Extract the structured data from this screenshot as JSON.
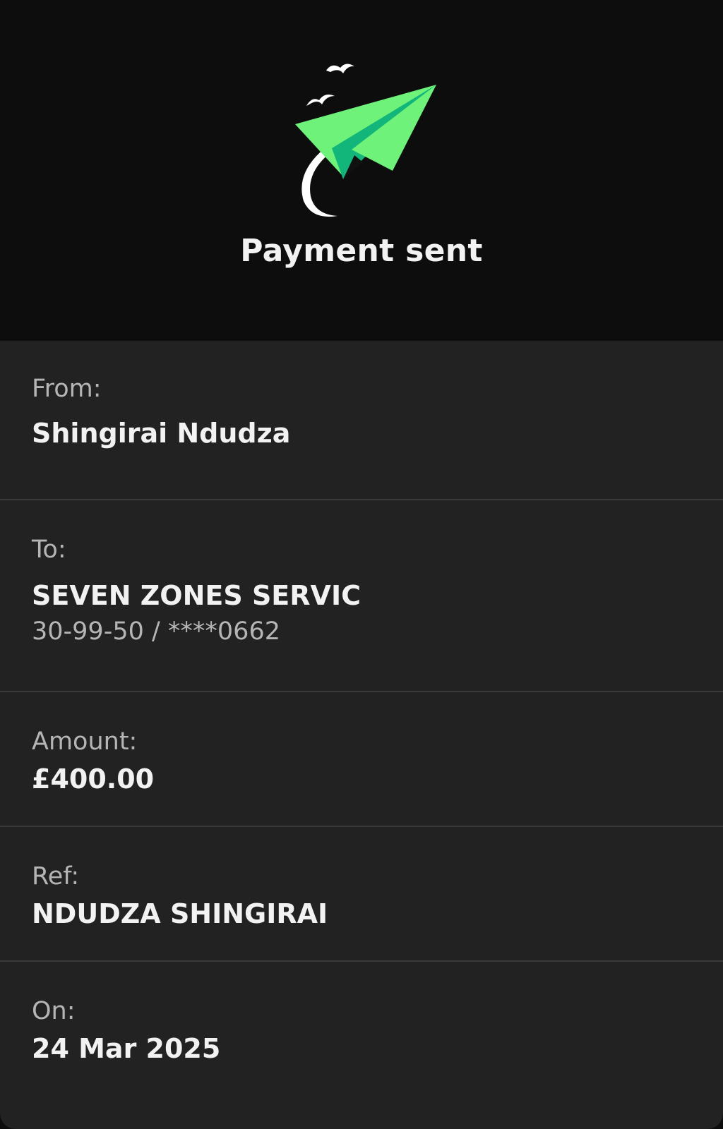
{
  "header": {
    "title": "Payment sent",
    "illustration_icon": "paper-plane-with-birds-icon",
    "accent_color": "#6ef27a"
  },
  "details": {
    "from": {
      "label": "From:",
      "name": "Shingirai Ndudza"
    },
    "to": {
      "label": "To:",
      "name": "SEVEN ZONES SERVIC",
      "account": "30-99-50 / ****0662"
    },
    "amount": {
      "label": "Amount:",
      "value": "£400.00"
    },
    "ref": {
      "label": "Ref:",
      "value": "NDUDZA SHINGIRAI"
    },
    "on": {
      "label": "On:",
      "value": "24 Mar 2025"
    }
  }
}
